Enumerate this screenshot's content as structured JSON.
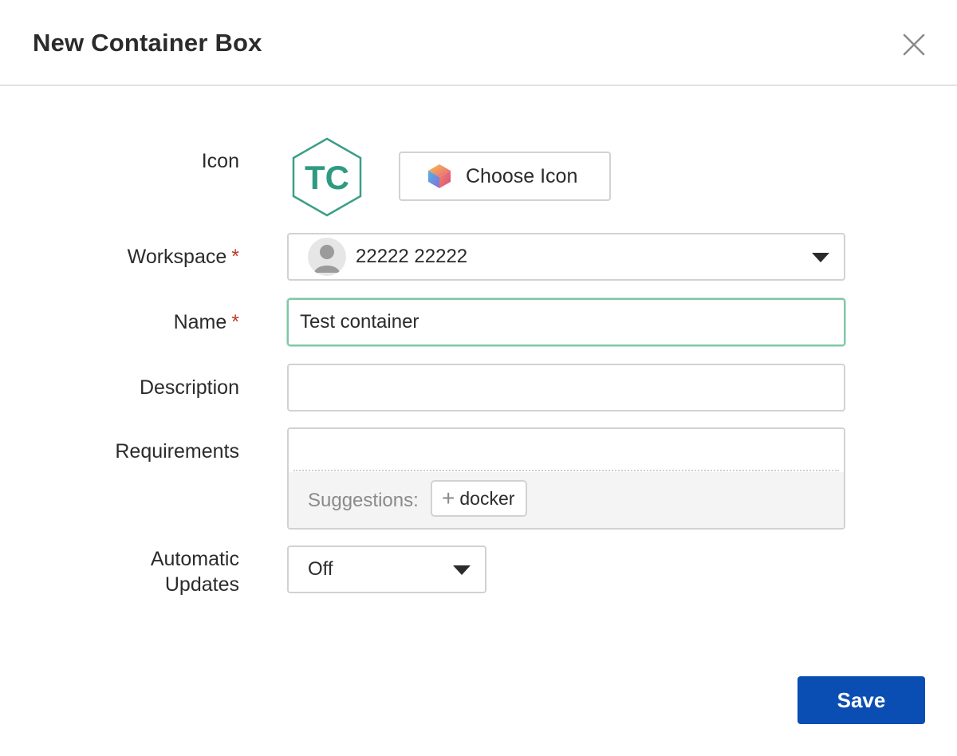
{
  "dialog": {
    "title": "New Container Box"
  },
  "icon_section": {
    "label": "Icon",
    "initials": "TC",
    "initials_color": "#2f9a82",
    "choose_button_label": "Choose Icon"
  },
  "workspace": {
    "label": "Workspace",
    "required_mark": "*",
    "selected_value": "22222 22222"
  },
  "name": {
    "label": "Name",
    "required_mark": "*",
    "value": "Test container",
    "focus_border_color": "#7fc7a4"
  },
  "description": {
    "label": "Description",
    "value": ""
  },
  "requirements": {
    "label": "Requirements",
    "value": "",
    "suggestions_label": "Suggestions:",
    "suggestions": [
      "docker"
    ]
  },
  "automatic_updates": {
    "label_line1": "Automatic",
    "label_line2": "Updates",
    "selected_value": "Off"
  },
  "actions": {
    "save_label": "Save",
    "save_color": "#0a4eb4"
  },
  "icons": {
    "close": "close-icon",
    "cube": "cube-icon",
    "avatar": "user-avatar-icon",
    "dropdown": "chevron-down-icon",
    "plus": "plus-icon"
  }
}
